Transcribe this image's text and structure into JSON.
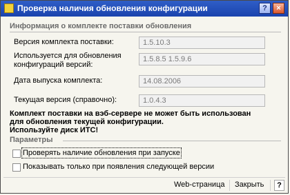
{
  "window": {
    "title": "Проверка наличия обновления конфигурации"
  },
  "info_group": {
    "title": "Информация о комплекте поставки обновления",
    "fields": [
      {
        "label": "Версия комплекта поставки:",
        "value": "1.5.10.3"
      },
      {
        "label_line1": "Используется для обновления",
        "label_line2": "конфигураций версий:",
        "value": "1.5.8.5  1.5.9.6"
      },
      {
        "label": "Дата выпуска комплекта:",
        "value": "14.08.2006"
      },
      {
        "label": "Текущая версия (справочно):",
        "value": "1.0.4.3"
      }
    ]
  },
  "warning": {
    "line1": "Комплект поставки на вэб-сервере не может быть использован",
    "line2": "для обновления текущей конфигурации.",
    "line3": "Используйте диск ИТС!"
  },
  "params_group": {
    "title": "Параметры",
    "checkboxes": [
      {
        "label": "Проверять наличие обновления при запуске",
        "checked": false
      },
      {
        "label": "Показывать только при появления следующей версии",
        "checked": false
      }
    ]
  },
  "footer": {
    "web_label": "Web-страница",
    "close_label": "Закрыть",
    "help_label": "?"
  },
  "titlebar": {
    "help_label": "?",
    "close_label": "×"
  },
  "colors": {
    "titlebar": "#2258c9",
    "background": "#f6f5ee",
    "field_background": "#f1f1f1"
  }
}
